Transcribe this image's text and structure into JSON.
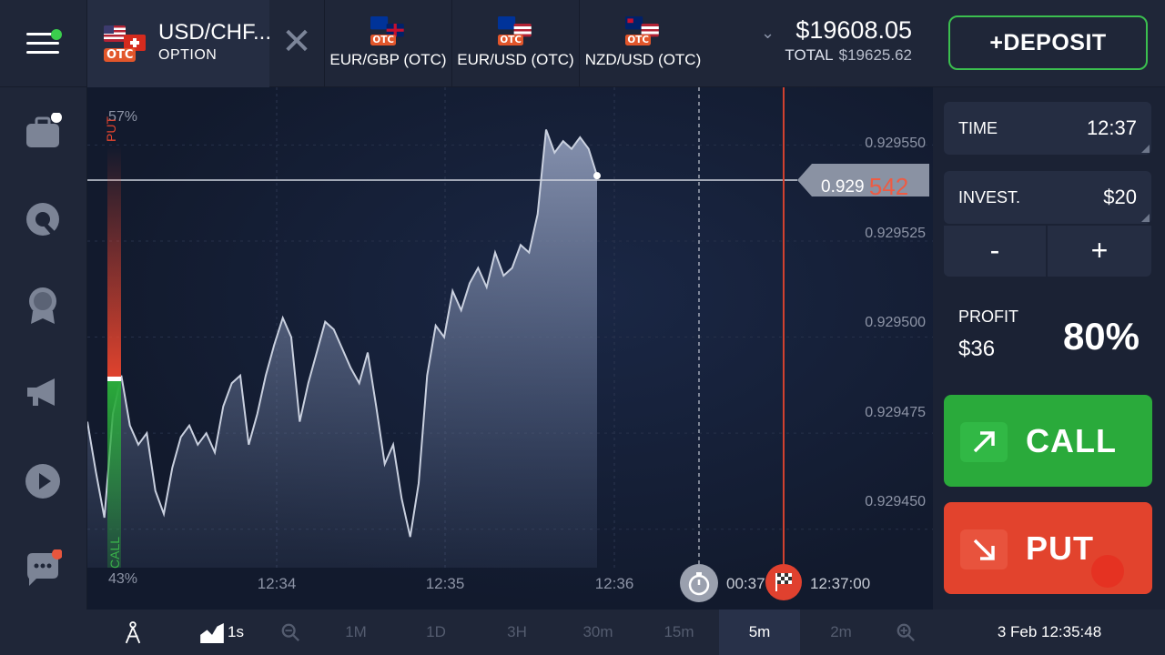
{
  "colors": {
    "call": "#2aaa3b",
    "put": "#e2432d",
    "deposit_border": "#3bbf4f",
    "otc_tag": "#e2562b",
    "price_highlight": "#ee5b43",
    "chart_line": "#c9d0df"
  },
  "topbar": {
    "active_asset": {
      "name": "USD/CHF...",
      "type": "OPTION",
      "otc_label": "OTC"
    },
    "close_icon": "close-icon",
    "tabs": [
      {
        "label": "EUR/GBP (OTC)",
        "otc_label": "OTC"
      },
      {
        "label": "EUR/USD (OTC)",
        "otc_label": "OTC"
      },
      {
        "label": "NZD/USD (OTC)",
        "otc_label": "OTC"
      }
    ],
    "balance": "$19608.05",
    "total_label": "TOTAL",
    "total_value": "$19625.62",
    "deposit_label": "+DEPOSIT"
  },
  "sidebar": {
    "items": [
      {
        "icon": "briefcase-icon"
      },
      {
        "icon": "headphones-icon"
      },
      {
        "icon": "award-icon"
      },
      {
        "icon": "megaphone-icon"
      },
      {
        "icon": "play-icon"
      },
      {
        "icon": "chat-icon"
      }
    ]
  },
  "chart": {
    "current_price_prefix": "0.929",
    "current_price_suffix": "542",
    "price_ticks": [
      "0.929550",
      "0.929525",
      "0.929500",
      "0.929475",
      "0.929450"
    ],
    "time_ticks": [
      "12:34",
      "12:35",
      "12:36"
    ],
    "sentiment_top": "57%",
    "sentiment_bottom": "43%",
    "put_label": "PUT",
    "call_label": "CALL",
    "timer": "00:37",
    "expiry_time": "12:37:00"
  },
  "chart_data": {
    "type": "area",
    "y_range": [
      0.92944,
      0.929565
    ],
    "x_range": [
      "12:33:40",
      "12:37:15"
    ],
    "series": [
      {
        "values": [
          0.929478,
          0.929465,
          0.929453,
          0.92948,
          0.92949,
          0.929477,
          0.929472,
          0.929475,
          0.92946,
          0.929454,
          0.929466,
          0.929474,
          0.929477,
          0.929472,
          0.929475,
          0.92947,
          0.929482,
          0.929488,
          0.92949,
          0.929472,
          0.92948,
          0.92949,
          0.929498,
          0.929505,
          0.9295,
          0.929478,
          0.929488,
          0.929496,
          0.929504,
          0.929502,
          0.929497,
          0.929492,
          0.929488,
          0.929496,
          0.929482,
          0.929467,
          0.929472,
          0.929458,
          0.929448,
          0.929462,
          0.92949,
          0.929503,
          0.9295,
          0.929512,
          0.929507,
          0.929514,
          0.929518,
          0.929513,
          0.929522,
          0.929516,
          0.929518,
          0.929524,
          0.929522,
          0.929532,
          0.929554,
          0.929548,
          0.929551,
          0.929549,
          0.929552,
          0.929549,
          0.929542
        ]
      }
    ]
  },
  "right_panel": {
    "time_label": "TIME",
    "time_value": "12:37",
    "invest_label": "INVEST.",
    "invest_value": "$20",
    "minus": "-",
    "plus": "+",
    "profit_label": "PROFIT",
    "profit_amount": "$36",
    "profit_pct": "80%",
    "call_label": "CALL",
    "put_label": "PUT"
  },
  "bottombar": {
    "chart_type_label": "1s",
    "timeframes": [
      "1M",
      "1D",
      "3H",
      "30m",
      "15m",
      "5m",
      "2m"
    ],
    "active_timeframe": "5m",
    "datetime": "3 Feb 12:35:48"
  }
}
